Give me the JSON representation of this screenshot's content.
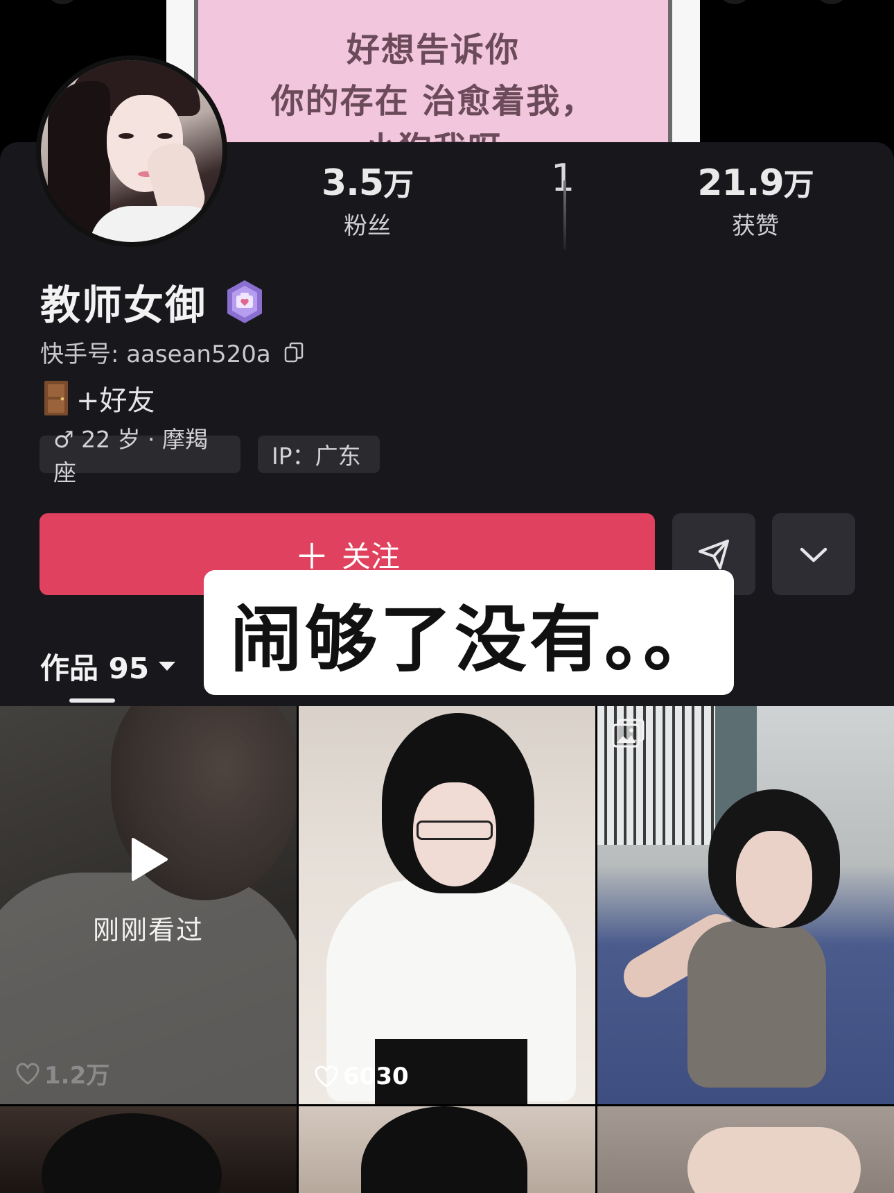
{
  "banner": {
    "line1": "好想告诉你",
    "line2": "你的存在 治愈着我，",
    "line3": "小狗我呀"
  },
  "profile": {
    "stats": {
      "followers_value": "3.5",
      "followers_unit": "万",
      "followers_label": "粉丝",
      "following_value": "1",
      "likes_value": "21.9",
      "likes_unit": "万",
      "likes_label": "获赞"
    },
    "name": "教师女御",
    "kuaishou_id": "快手号: aasean520a",
    "bio": "+好友",
    "tags": {
      "age_sign": "♂ 22 岁 · 摩羯座",
      "ip": "IP：广东"
    },
    "follow_label": "关注",
    "follow_plus": "＋",
    "icons": {
      "badge": "badge-icon",
      "copy": "copy-icon",
      "door": "door-icon",
      "send": "send-icon",
      "more": "chevron-down-icon"
    },
    "accent_color": "#e0415e"
  },
  "tabs": {
    "works_label": "作品 95"
  },
  "subtitle": {
    "text": "闹够了没有。。"
  },
  "works": [
    {
      "likes": "1.2万",
      "overlay_label": "刚刚看过",
      "recently_viewed": true
    },
    {
      "likes": "6030"
    },
    {
      "likes": "",
      "type": "gallery"
    },
    {
      "likes": ""
    },
    {
      "likes": ""
    },
    {
      "likes": ""
    }
  ]
}
